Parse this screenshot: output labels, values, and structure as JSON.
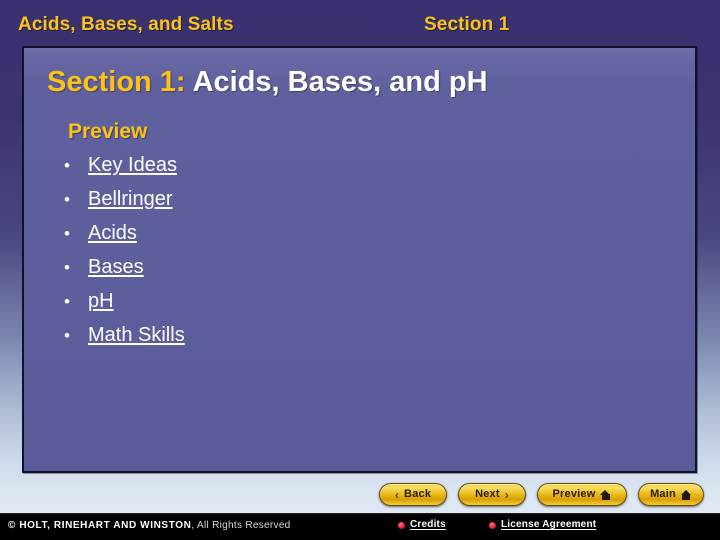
{
  "header": {
    "chapter_title": "Acids, Bases, and Salts",
    "section_label": "Section 1"
  },
  "slide": {
    "title_accent": "Section 1:",
    "title_main": "Acids, Bases, and pH",
    "preview_heading": "Preview",
    "bullet_glyph": "•",
    "preview_items": [
      {
        "label": "Key Ideas"
      },
      {
        "label": "Bellringer"
      },
      {
        "label": "Acids"
      },
      {
        "label": "Bases"
      },
      {
        "label": "pH"
      },
      {
        "label": "Math Skills"
      }
    ]
  },
  "nav": {
    "back": {
      "label": "Back",
      "chevron": "‹",
      "icon": "chevron-left-icon"
    },
    "next": {
      "label": "Next",
      "chevron": "›",
      "icon": "chevron-right-icon"
    },
    "preview": {
      "label": "Preview",
      "icon": "home-icon"
    },
    "main": {
      "label": "Main",
      "icon": "home-icon"
    }
  },
  "footer": {
    "copyright_bold": "© HOLT, RINEHART AND WINSTON",
    "copyright_regular": ", All Rights Reserved",
    "credits_label": "Credits",
    "license_label": "License Agreement"
  },
  "colors": {
    "accent_gold": "#fcc316",
    "panel_purple": "#5d5e9c",
    "stage_top": "#39316f",
    "stage_bottom": "#e2ebf6",
    "button_gold": "#e8b712",
    "footer_black": "#000000",
    "footer_dot_red": "#e01e3c"
  }
}
